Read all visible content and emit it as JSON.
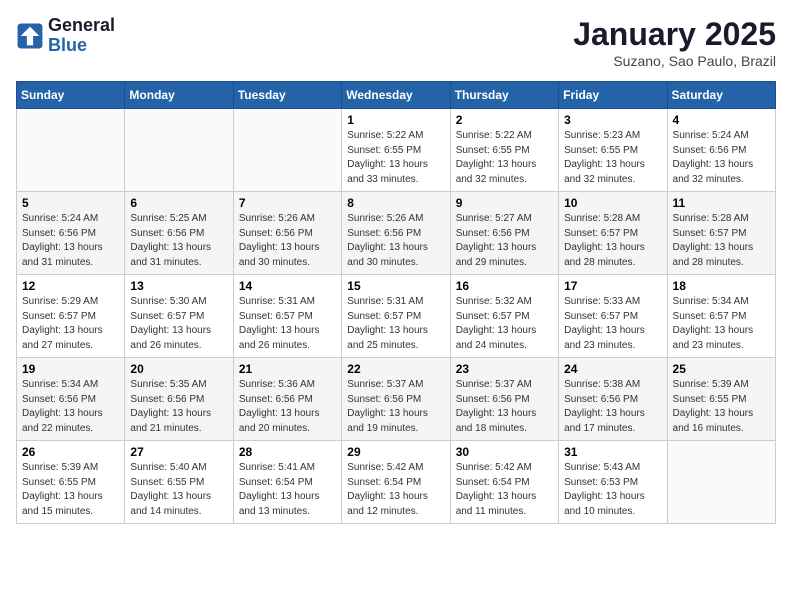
{
  "header": {
    "logo_general": "General",
    "logo_blue": "Blue",
    "title": "January 2025",
    "subtitle": "Suzano, Sao Paulo, Brazil"
  },
  "days_of_week": [
    "Sunday",
    "Monday",
    "Tuesday",
    "Wednesday",
    "Thursday",
    "Friday",
    "Saturday"
  ],
  "weeks": [
    [
      {
        "day": "",
        "info": ""
      },
      {
        "day": "",
        "info": ""
      },
      {
        "day": "",
        "info": ""
      },
      {
        "day": "1",
        "info": "Sunrise: 5:22 AM\nSunset: 6:55 PM\nDaylight: 13 hours and 33 minutes."
      },
      {
        "day": "2",
        "info": "Sunrise: 5:22 AM\nSunset: 6:55 PM\nDaylight: 13 hours and 32 minutes."
      },
      {
        "day": "3",
        "info": "Sunrise: 5:23 AM\nSunset: 6:55 PM\nDaylight: 13 hours and 32 minutes."
      },
      {
        "day": "4",
        "info": "Sunrise: 5:24 AM\nSunset: 6:56 PM\nDaylight: 13 hours and 32 minutes."
      }
    ],
    [
      {
        "day": "5",
        "info": "Sunrise: 5:24 AM\nSunset: 6:56 PM\nDaylight: 13 hours and 31 minutes."
      },
      {
        "day": "6",
        "info": "Sunrise: 5:25 AM\nSunset: 6:56 PM\nDaylight: 13 hours and 31 minutes."
      },
      {
        "day": "7",
        "info": "Sunrise: 5:26 AM\nSunset: 6:56 PM\nDaylight: 13 hours and 30 minutes."
      },
      {
        "day": "8",
        "info": "Sunrise: 5:26 AM\nSunset: 6:56 PM\nDaylight: 13 hours and 30 minutes."
      },
      {
        "day": "9",
        "info": "Sunrise: 5:27 AM\nSunset: 6:56 PM\nDaylight: 13 hours and 29 minutes."
      },
      {
        "day": "10",
        "info": "Sunrise: 5:28 AM\nSunset: 6:57 PM\nDaylight: 13 hours and 28 minutes."
      },
      {
        "day": "11",
        "info": "Sunrise: 5:28 AM\nSunset: 6:57 PM\nDaylight: 13 hours and 28 minutes."
      }
    ],
    [
      {
        "day": "12",
        "info": "Sunrise: 5:29 AM\nSunset: 6:57 PM\nDaylight: 13 hours and 27 minutes."
      },
      {
        "day": "13",
        "info": "Sunrise: 5:30 AM\nSunset: 6:57 PM\nDaylight: 13 hours and 26 minutes."
      },
      {
        "day": "14",
        "info": "Sunrise: 5:31 AM\nSunset: 6:57 PM\nDaylight: 13 hours and 26 minutes."
      },
      {
        "day": "15",
        "info": "Sunrise: 5:31 AM\nSunset: 6:57 PM\nDaylight: 13 hours and 25 minutes."
      },
      {
        "day": "16",
        "info": "Sunrise: 5:32 AM\nSunset: 6:57 PM\nDaylight: 13 hours and 24 minutes."
      },
      {
        "day": "17",
        "info": "Sunrise: 5:33 AM\nSunset: 6:57 PM\nDaylight: 13 hours and 23 minutes."
      },
      {
        "day": "18",
        "info": "Sunrise: 5:34 AM\nSunset: 6:57 PM\nDaylight: 13 hours and 23 minutes."
      }
    ],
    [
      {
        "day": "19",
        "info": "Sunrise: 5:34 AM\nSunset: 6:56 PM\nDaylight: 13 hours and 22 minutes."
      },
      {
        "day": "20",
        "info": "Sunrise: 5:35 AM\nSunset: 6:56 PM\nDaylight: 13 hours and 21 minutes."
      },
      {
        "day": "21",
        "info": "Sunrise: 5:36 AM\nSunset: 6:56 PM\nDaylight: 13 hours and 20 minutes."
      },
      {
        "day": "22",
        "info": "Sunrise: 5:37 AM\nSunset: 6:56 PM\nDaylight: 13 hours and 19 minutes."
      },
      {
        "day": "23",
        "info": "Sunrise: 5:37 AM\nSunset: 6:56 PM\nDaylight: 13 hours and 18 minutes."
      },
      {
        "day": "24",
        "info": "Sunrise: 5:38 AM\nSunset: 6:56 PM\nDaylight: 13 hours and 17 minutes."
      },
      {
        "day": "25",
        "info": "Sunrise: 5:39 AM\nSunset: 6:55 PM\nDaylight: 13 hours and 16 minutes."
      }
    ],
    [
      {
        "day": "26",
        "info": "Sunrise: 5:39 AM\nSunset: 6:55 PM\nDaylight: 13 hours and 15 minutes."
      },
      {
        "day": "27",
        "info": "Sunrise: 5:40 AM\nSunset: 6:55 PM\nDaylight: 13 hours and 14 minutes."
      },
      {
        "day": "28",
        "info": "Sunrise: 5:41 AM\nSunset: 6:54 PM\nDaylight: 13 hours and 13 minutes."
      },
      {
        "day": "29",
        "info": "Sunrise: 5:42 AM\nSunset: 6:54 PM\nDaylight: 13 hours and 12 minutes."
      },
      {
        "day": "30",
        "info": "Sunrise: 5:42 AM\nSunset: 6:54 PM\nDaylight: 13 hours and 11 minutes."
      },
      {
        "day": "31",
        "info": "Sunrise: 5:43 AM\nSunset: 6:53 PM\nDaylight: 13 hours and 10 minutes."
      },
      {
        "day": "",
        "info": ""
      }
    ]
  ]
}
